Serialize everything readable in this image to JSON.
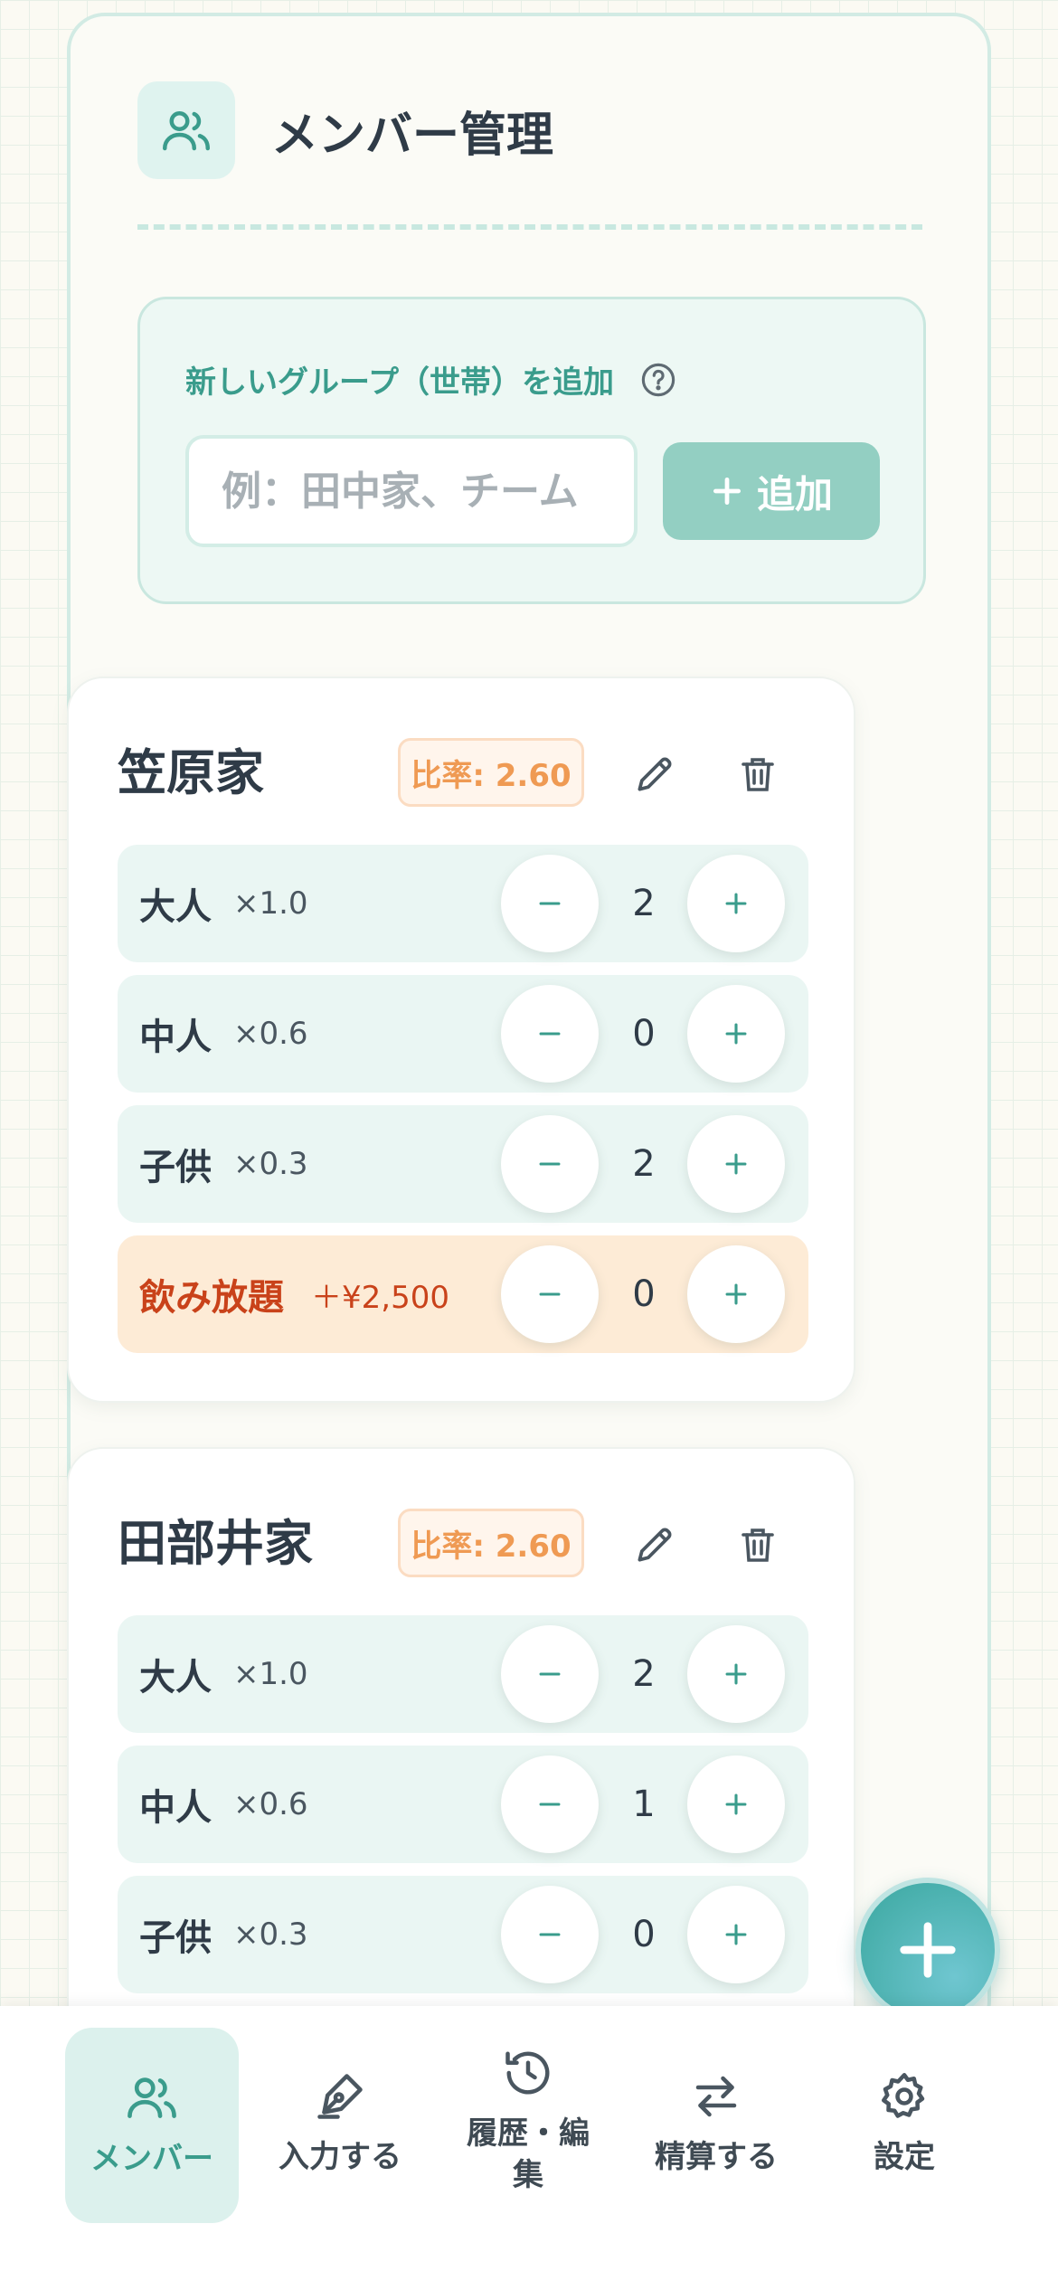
{
  "header": {
    "title": "メンバー管理",
    "icon": "users-icon"
  },
  "add_group": {
    "label": "新しいグループ（世帯）を追加",
    "input_value": "",
    "placeholder": "例：田中家、チーム",
    "button_label": "追加"
  },
  "households": [
    {
      "name": "笠原家",
      "ratio": "比率: 2.60",
      "rows": [
        {
          "label": "大人",
          "multiplier": "×1.0",
          "count": "2"
        },
        {
          "label": "中人",
          "multiplier": "×0.6",
          "count": "0"
        },
        {
          "label": "子供",
          "multiplier": "×0.3",
          "count": "2"
        },
        {
          "label": "飲み放題",
          "multiplier": "＋¥2,500",
          "count": "0"
        }
      ]
    },
    {
      "name": "田部井家",
      "ratio": "比率: 2.60",
      "rows": [
        {
          "label": "大人",
          "multiplier": "×1.0",
          "count": "2"
        },
        {
          "label": "中人",
          "multiplier": "×0.6",
          "count": "1"
        },
        {
          "label": "子供",
          "multiplier": "×0.3",
          "count": "0"
        }
      ]
    }
  ],
  "nav": [
    {
      "label": "メンバー",
      "icon": "users-icon",
      "active": true
    },
    {
      "label": "入力する",
      "icon": "pen-icon",
      "active": false
    },
    {
      "label": "履歴・編集",
      "icon": "history-icon",
      "active": false
    },
    {
      "label": "精算する",
      "icon": "transfer-icon",
      "active": false
    },
    {
      "label": "設定",
      "icon": "gear-icon",
      "active": false
    }
  ],
  "colors": {
    "accent": "#3a9c8c",
    "ratio_text": "#ef9a53",
    "drink_text": "#c9421a"
  }
}
